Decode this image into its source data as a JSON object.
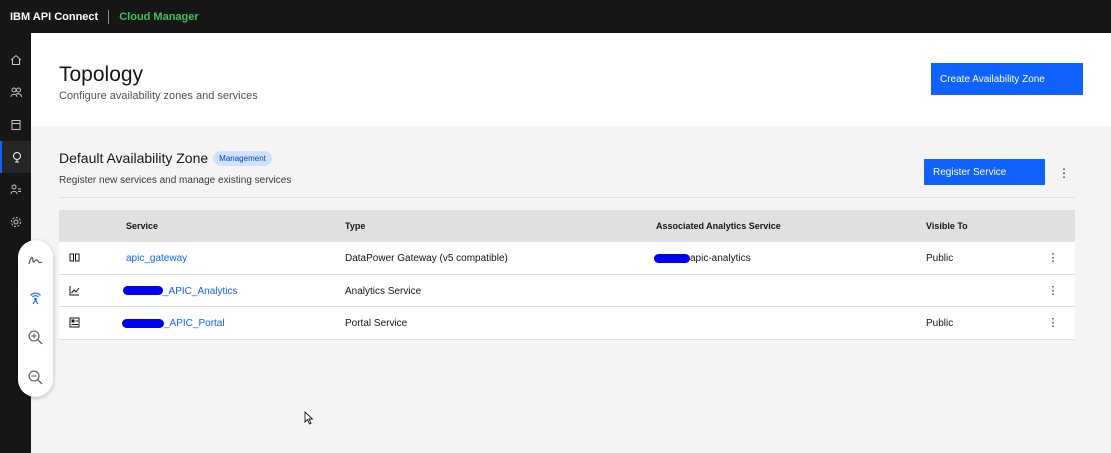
{
  "topbar": {
    "brand": "IBM API Connect",
    "product": "Cloud Manager"
  },
  "nav": {
    "items": [
      {
        "name": "home-icon"
      },
      {
        "name": "users-icon"
      },
      {
        "name": "catalog-icon"
      },
      {
        "name": "topology-icon",
        "active": true
      },
      {
        "name": "members-icon"
      },
      {
        "name": "settings-icon"
      }
    ]
  },
  "header": {
    "title": "Topology",
    "subtitle": "Configure availability zones and services",
    "create_button": "Create Availability Zone"
  },
  "zone": {
    "title": "Default Availability Zone",
    "tag": "Management",
    "subtitle": "Register new services and manage existing services",
    "register_button": "Register Service",
    "overflow": "⋮"
  },
  "table": {
    "headers": {
      "service": "Service",
      "type": "Type",
      "analytics": "Associated Analytics Service",
      "visible": "Visible To"
    },
    "rows": [
      {
        "icon": "gateway-icon",
        "service": "apic_gateway",
        "type": "DataPower Gateway (v5 compatible)",
        "analytics": "apic-analytics",
        "visible": "Public",
        "overflow": "⋮"
      },
      {
        "icon": "analytics-icon",
        "service": "_APIC_Analytics",
        "type": "Analytics Service",
        "analytics": "",
        "visible": "",
        "overflow": "⋮"
      },
      {
        "icon": "portal-icon",
        "service": "_APIC_Portal",
        "type": "Portal Service",
        "analytics": "",
        "visible": "Public",
        "overflow": "⋮"
      }
    ]
  },
  "tools": [
    {
      "name": "draw-icon"
    },
    {
      "name": "broadcast-icon"
    },
    {
      "name": "zoom-in-icon"
    },
    {
      "name": "zoom-out-icon"
    }
  ],
  "colors": {
    "accent": "#0f62fe",
    "topbar": "#161616",
    "product": "#42be65",
    "redaction": "#0000ee"
  }
}
